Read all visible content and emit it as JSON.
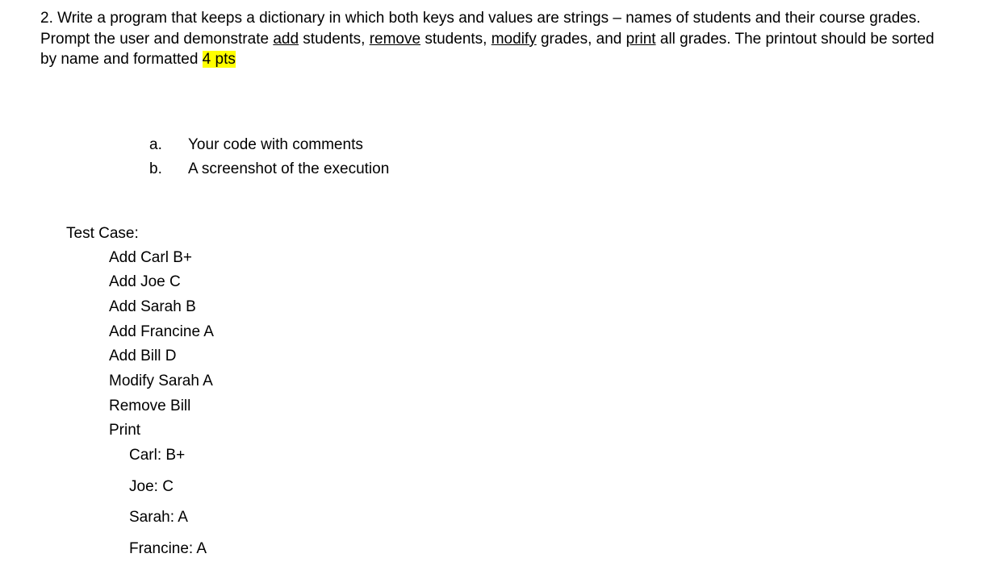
{
  "question": {
    "number": "2.",
    "text_part1": " Write a program that keeps a dictionary in which both keys and values are strings – names of students and their course grades.  Prompt the user and demonstrate ",
    "u1": "add",
    "text_part2": " students, ",
    "u2": "remove",
    "text_part3": " students, ",
    "u3": "modify",
    "text_part4": " grades, and ",
    "u4": "print",
    "text_part5": " all grades.  The printout should be sorted by name and formatted ",
    "highlight": "4 pts"
  },
  "sublist": [
    {
      "marker": "a.",
      "text": "Your code with comments"
    },
    {
      "marker": "b.",
      "text": "A screenshot of the execution"
    }
  ],
  "testcase": {
    "header": "Test Case:",
    "commands": [
      "Add Carl B+",
      "Add Joe C",
      "Add Sarah B",
      "Add Francine A",
      "Add Bill D",
      "Modify Sarah A",
      "Remove Bill",
      "Print"
    ],
    "output": [
      "Carl: B+",
      "Joe: C",
      "Sarah: A",
      "Francine: A"
    ]
  }
}
